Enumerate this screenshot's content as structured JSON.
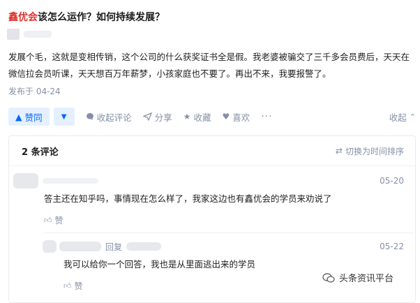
{
  "question": {
    "title_highlight": "鑫优会",
    "title_rest": "该怎么运作？如何持续发展？"
  },
  "answer": {
    "text": "发展个毛，这就是变相传销，这个公司的什么获奖证书全是假。我老婆被骗交了三千多会员费后，天天在微信拉会员听课，天天想百万年薪梦，小孩家庭也不要了。再出不来，我要报警了。",
    "published": "发布于 04-24"
  },
  "actions": {
    "upvote_label": "赞同",
    "collect_comments": "收起评论",
    "share": "分享",
    "favorite": "收藏",
    "like": "喜欢",
    "more": "···",
    "collapse": "收起"
  },
  "comments": {
    "count_label": "2 条评论",
    "sort_label": "切换为时间排序",
    "items": [
      {
        "date": "05-20",
        "text": "答主还在知乎吗，事情现在怎么样了，我家这边也有鑫优会的学员来劝说了",
        "like_label": "赞"
      },
      {
        "reply_label": "回复",
        "date": "05-22",
        "text": "我可以给你一个回答，我也是从里面逃出来的学员",
        "like_label": "赞"
      }
    ]
  },
  "watermark": {
    "text": "头条资讯平台"
  },
  "colors": {
    "accent": "#0066ff",
    "highlight": "#e0302b",
    "muted": "#8590a6"
  }
}
